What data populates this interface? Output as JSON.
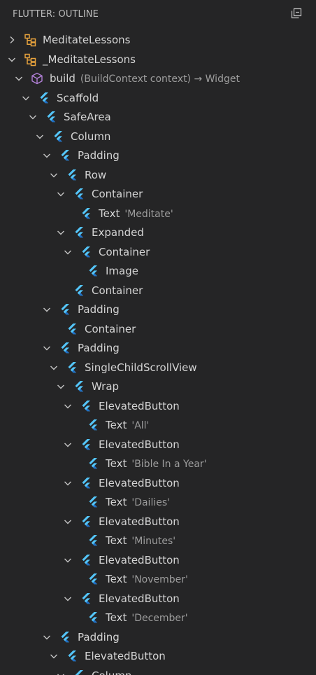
{
  "header": {
    "title": "FLUTTER: OUTLINE"
  },
  "colors": {
    "background": "#252526",
    "text": "#d4d4d4",
    "detail": "#9d9d9d",
    "class_icon": "#e8a33d",
    "method_icon": "#b180d7",
    "flutter_light": "#54c5f8",
    "flutter_dark": "#1f6fc5",
    "chevron": "#c5c5c5"
  },
  "tree": [
    {
      "depth": 0,
      "state": "collapsed",
      "icon": "class-icon",
      "label": "MeditateLessons",
      "detail": ""
    },
    {
      "depth": 0,
      "state": "expanded",
      "icon": "class-icon",
      "label": "_MeditateLessons",
      "detail": ""
    },
    {
      "depth": 1,
      "state": "expanded",
      "icon": "method-icon",
      "label": "build",
      "detail": "(BuildContext context) → Widget"
    },
    {
      "depth": 2,
      "state": "expanded",
      "icon": "flutter-widget-icon",
      "label": "Scaffold",
      "detail": ""
    },
    {
      "depth": 3,
      "state": "expanded",
      "icon": "flutter-widget-icon",
      "label": "SafeArea",
      "detail": ""
    },
    {
      "depth": 4,
      "state": "expanded",
      "icon": "flutter-widget-icon",
      "label": "Column",
      "detail": ""
    },
    {
      "depth": 5,
      "state": "expanded",
      "icon": "flutter-widget-icon",
      "label": "Padding",
      "detail": ""
    },
    {
      "depth": 6,
      "state": "expanded",
      "icon": "flutter-widget-icon",
      "label": "Row",
      "detail": ""
    },
    {
      "depth": 7,
      "state": "expanded",
      "icon": "flutter-widget-icon",
      "label": "Container",
      "detail": ""
    },
    {
      "depth": 8,
      "state": "leaf",
      "icon": "flutter-widget-icon",
      "label": "Text",
      "detail": "'Meditate'"
    },
    {
      "depth": 7,
      "state": "expanded",
      "icon": "flutter-widget-icon",
      "label": "Expanded",
      "detail": ""
    },
    {
      "depth": 8,
      "state": "expanded",
      "icon": "flutter-widget-icon",
      "label": "Container",
      "detail": ""
    },
    {
      "depth": 9,
      "state": "leaf",
      "icon": "flutter-widget-icon",
      "label": "Image",
      "detail": ""
    },
    {
      "depth": 7,
      "state": "leaf",
      "icon": "flutter-widget-icon",
      "label": "Container",
      "detail": ""
    },
    {
      "depth": 5,
      "state": "expanded",
      "icon": "flutter-widget-icon",
      "label": "Padding",
      "detail": ""
    },
    {
      "depth": 6,
      "state": "leaf",
      "icon": "flutter-widget-icon",
      "label": "Container",
      "detail": ""
    },
    {
      "depth": 5,
      "state": "expanded",
      "icon": "flutter-widget-icon",
      "label": "Padding",
      "detail": ""
    },
    {
      "depth": 6,
      "state": "expanded",
      "icon": "flutter-widget-icon",
      "label": "SingleChildScrollView",
      "detail": ""
    },
    {
      "depth": 7,
      "state": "expanded",
      "icon": "flutter-widget-icon",
      "label": "Wrap",
      "detail": ""
    },
    {
      "depth": 8,
      "state": "expanded",
      "icon": "flutter-widget-icon",
      "label": "ElevatedButton",
      "detail": ""
    },
    {
      "depth": 9,
      "state": "leaf",
      "icon": "flutter-widget-icon",
      "label": "Text",
      "detail": "'All'"
    },
    {
      "depth": 8,
      "state": "expanded",
      "icon": "flutter-widget-icon",
      "label": "ElevatedButton",
      "detail": ""
    },
    {
      "depth": 9,
      "state": "leaf",
      "icon": "flutter-widget-icon",
      "label": "Text",
      "detail": "'Bible In a Year'"
    },
    {
      "depth": 8,
      "state": "expanded",
      "icon": "flutter-widget-icon",
      "label": "ElevatedButton",
      "detail": ""
    },
    {
      "depth": 9,
      "state": "leaf",
      "icon": "flutter-widget-icon",
      "label": "Text",
      "detail": "'Dailies'"
    },
    {
      "depth": 8,
      "state": "expanded",
      "icon": "flutter-widget-icon",
      "label": "ElevatedButton",
      "detail": ""
    },
    {
      "depth": 9,
      "state": "leaf",
      "icon": "flutter-widget-icon",
      "label": "Text",
      "detail": "'Minutes'"
    },
    {
      "depth": 8,
      "state": "expanded",
      "icon": "flutter-widget-icon",
      "label": "ElevatedButton",
      "detail": ""
    },
    {
      "depth": 9,
      "state": "leaf",
      "icon": "flutter-widget-icon",
      "label": "Text",
      "detail": "'November'"
    },
    {
      "depth": 8,
      "state": "expanded",
      "icon": "flutter-widget-icon",
      "label": "ElevatedButton",
      "detail": ""
    },
    {
      "depth": 9,
      "state": "leaf",
      "icon": "flutter-widget-icon",
      "label": "Text",
      "detail": "'December'"
    },
    {
      "depth": 5,
      "state": "expanded",
      "icon": "flutter-widget-icon",
      "label": "Padding",
      "detail": ""
    },
    {
      "depth": 6,
      "state": "expanded",
      "icon": "flutter-widget-icon",
      "label": "ElevatedButton",
      "detail": ""
    },
    {
      "depth": 7,
      "state": "expanded",
      "icon": "flutter-widget-icon",
      "label": "Column",
      "detail": ""
    }
  ]
}
